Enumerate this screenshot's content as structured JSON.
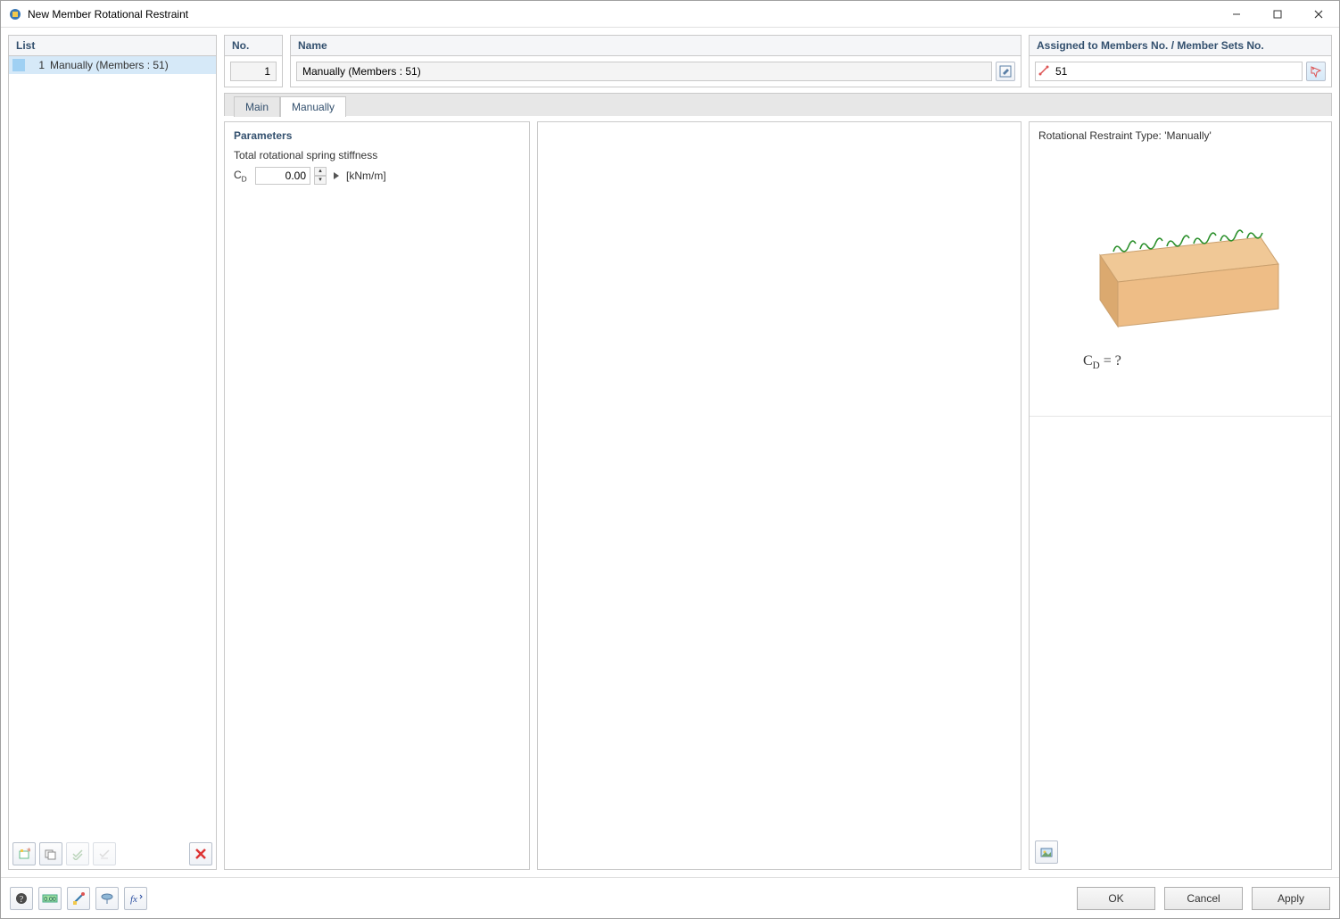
{
  "window": {
    "title": "New Member Rotational Restraint"
  },
  "list": {
    "header": "List",
    "items": [
      {
        "index": "1",
        "label": "Manually (Members : 51)"
      }
    ]
  },
  "no": {
    "header": "No.",
    "value": "1"
  },
  "name": {
    "header": "Name",
    "value": "Manually (Members : 51)"
  },
  "assign": {
    "header": "Assigned to Members No. / Member Sets No.",
    "value": "51"
  },
  "tabs": {
    "main": "Main",
    "manually": "Manually"
  },
  "params": {
    "section": "Parameters",
    "label": "Total rotational spring stiffness",
    "symbol_html": "C<sub>D</sub>",
    "value": "0.00",
    "unit": "[kNm/m]"
  },
  "right": {
    "title": "Rotational Restraint Type: 'Manually'",
    "formula_html": "C<sub>D</sub>  =  ?"
  },
  "footer": {
    "ok": "OK",
    "cancel": "Cancel",
    "apply": "Apply"
  },
  "icons": {
    "new_item": "new-item-icon",
    "copy_item": "copy-item-icon",
    "check_all": "check-all-icon",
    "uncheck_all": "uncheck-all-icon",
    "delete": "delete-icon",
    "edit_name": "edit-name-icon",
    "pick": "pick-icon",
    "help": "help-icon",
    "units": "units-icon",
    "members": "members-icon",
    "view": "view-icon",
    "fx": "fx-icon",
    "image_tool": "image-tool-icon"
  }
}
